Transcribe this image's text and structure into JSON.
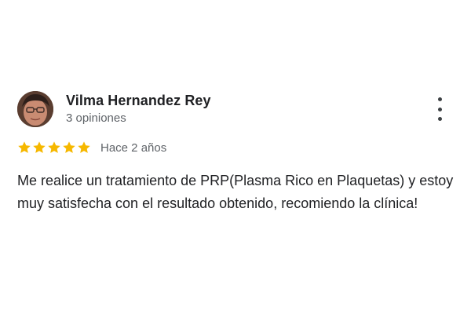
{
  "review": {
    "reviewer_name": "Vilma Hernandez Rey",
    "review_count": "3 opiniones",
    "rating": 5,
    "rating_max": 5,
    "date": "Hace 2 años",
    "text": "Me realice un tratamiento de PRP(Plasma Rico en Plaquetas) y estoy muy satisfecha con el resultado obtenido, recomiendo la clínica!"
  },
  "icons": {
    "avatar": "profile-photo",
    "star": "star-icon",
    "more": "more-vert-icon"
  },
  "colors": {
    "star": "#F6B800",
    "name_text": "#202124",
    "secondary_text": "#5F6368",
    "menu_dots": "#3C4043"
  }
}
